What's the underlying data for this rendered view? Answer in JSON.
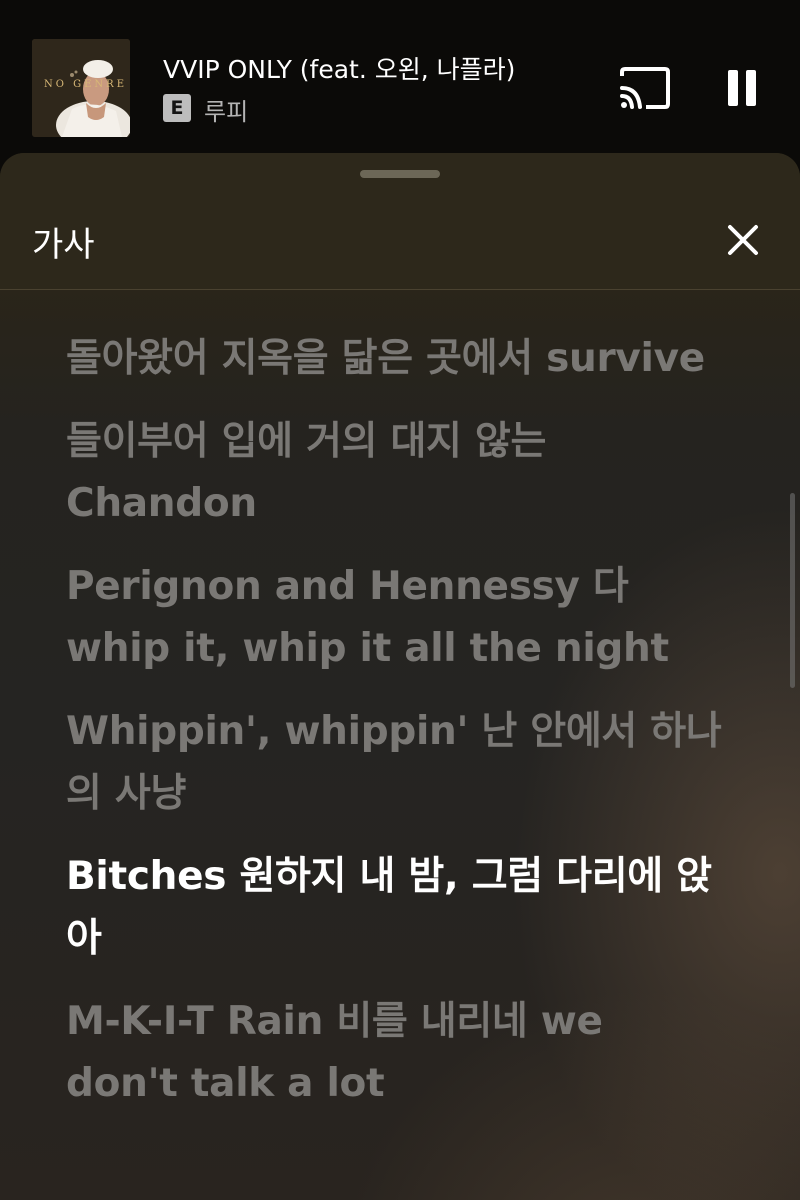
{
  "mini_player": {
    "song_title": "VVIP ONLY (feat. 오왼, 나플라)",
    "explicit_label": "E",
    "artist": "루피",
    "album_art_text": "NO GENRE",
    "cast_icon": "cast-icon",
    "pause_icon": "pause-icon"
  },
  "lyrics_sheet": {
    "title": "가사",
    "close_icon": "close-icon",
    "lines": [
      {
        "text": "돌아왔어 지옥을 닮은 곳에서 survive",
        "active": false
      },
      {
        "text": "들이부어 입에 거의 대지 않는 Chandon",
        "active": false
      },
      {
        "text": "Perignon and Hennessy 다 whip it, whip it all the night",
        "active": false
      },
      {
        "text": "Whippin', whippin' 난 안에서 하나의 사냥",
        "active": false
      },
      {
        "text": "Bitches 원하지 내 밤, 그럼 다리에 앉아",
        "active": true
      },
      {
        "text": "M-K-I-T Rain 비를 내리네 we don't talk a lot",
        "active": false
      }
    ]
  },
  "colors": {
    "active_lyric": "#ffffff",
    "inactive_lyric": "#7a7875",
    "sheet_header": "#2d281b",
    "background": "#0b0a08"
  }
}
